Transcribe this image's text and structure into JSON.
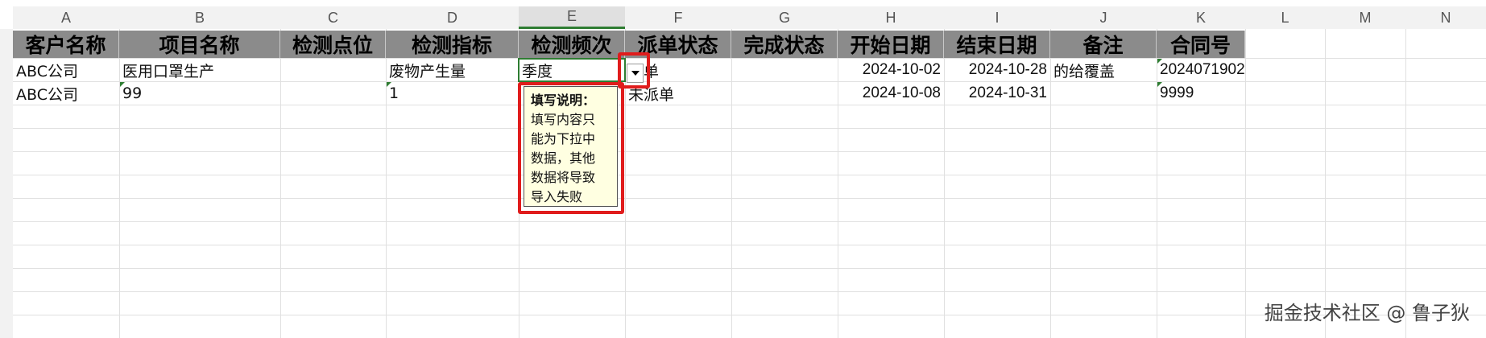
{
  "columns": [
    "A",
    "B",
    "C",
    "D",
    "E",
    "F",
    "G",
    "H",
    "I",
    "J",
    "K",
    "L",
    "M",
    "N"
  ],
  "header_row": [
    "客户名称",
    "项目名称",
    "检测点位",
    "检测指标",
    "检测频次",
    "派单状态",
    "完成状态",
    "开始日期",
    "结束日期",
    "备注",
    "合同号"
  ],
  "rows": [
    {
      "customer": "ABC公司",
      "project": "医用口罩生产",
      "point": "",
      "indicator": "废物产生量",
      "frequency": "季度",
      "dispatch": "派单",
      "completion": "",
      "start": "2024-10-02",
      "end": "2024-10-28",
      "note": "的给覆盖",
      "contract": "2024071902"
    },
    {
      "customer": "ABC公司",
      "project": "99",
      "point": "",
      "indicator": "1",
      "frequency": "",
      "dispatch": "未派单",
      "completion": "",
      "start": "2024-10-08",
      "end": "2024-10-31",
      "note": "",
      "contract": "9999"
    }
  ],
  "tooltip": {
    "title": "填写说明：",
    "lines": [
      "填写内容只",
      "能为下拉中",
      "数据，其他",
      "数据将导致",
      "导入失败"
    ]
  },
  "watermark": "掘金技术社区 @ 鲁子狄",
  "colors": {
    "header_bg": "#8b8b8b",
    "highlight": "#e01c1c",
    "selection": "#2e7d32",
    "tooltip_bg": "#ffffe1"
  }
}
